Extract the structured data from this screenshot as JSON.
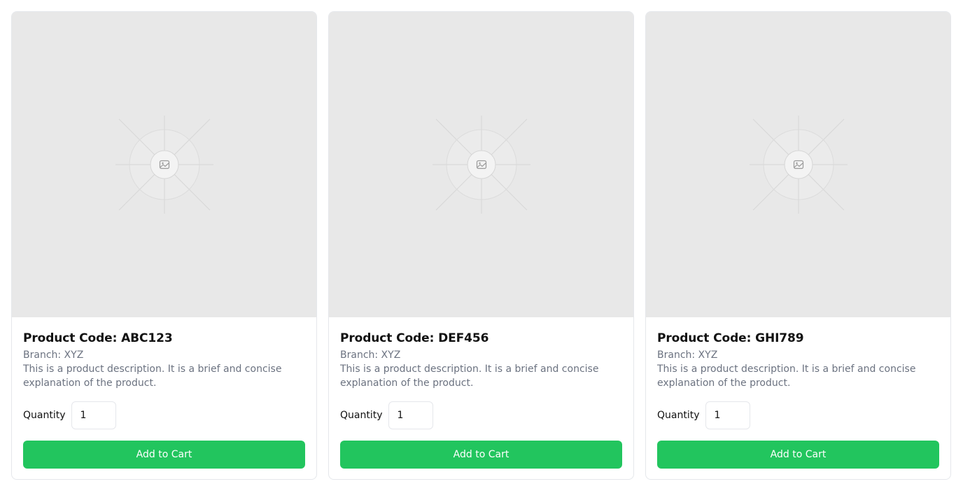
{
  "products": [
    {
      "title": "Product Code: ABC123",
      "branch": "Branch: XYZ",
      "description": "This is a product description. It is a brief and concise explanation of the product.",
      "quantity_label": "Quantity",
      "quantity_value": "1",
      "button_label": "Add to Cart",
      "image_icon": "image-placeholder-icon"
    },
    {
      "title": "Product Code: DEF456",
      "branch": "Branch: XYZ",
      "description": "This is a product description. It is a brief and concise explanation of the product.",
      "quantity_label": "Quantity",
      "quantity_value": "1",
      "button_label": "Add to Cart",
      "image_icon": "image-placeholder-icon"
    },
    {
      "title": "Product Code: GHI789",
      "branch": "Branch: XYZ",
      "description": "This is a product description. It is a brief and concise explanation of the product.",
      "quantity_label": "Quantity",
      "quantity_value": "1",
      "button_label": "Add to Cart",
      "image_icon": "image-placeholder-icon"
    }
  ],
  "colors": {
    "button_bg": "#22c55e",
    "image_bg": "#e8e8e8",
    "muted_text": "#6b7280",
    "border": "#e5e7eb"
  }
}
